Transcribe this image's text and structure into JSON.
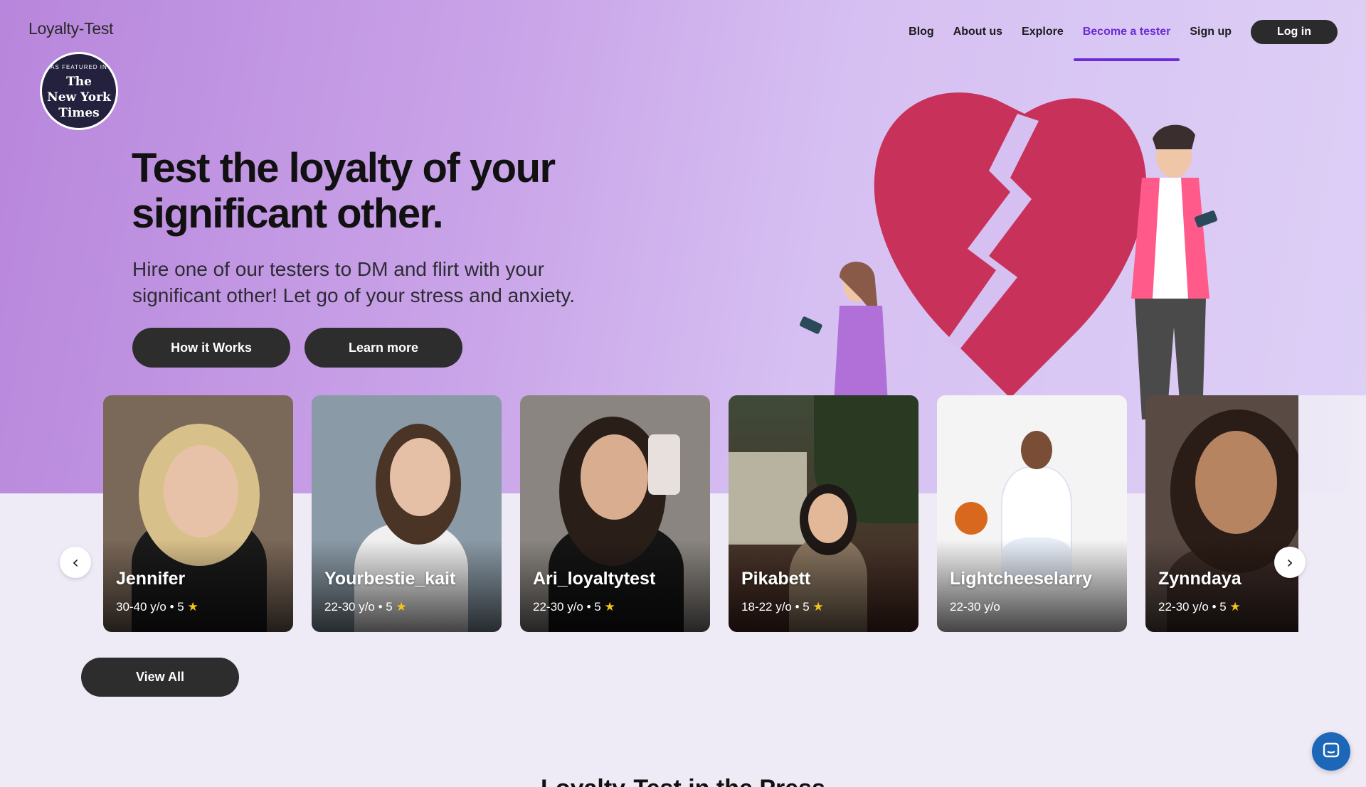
{
  "header": {
    "brand": "Loyalty-Test",
    "nav": [
      "Blog",
      "About us",
      "Explore",
      "Become a tester",
      "Sign up"
    ],
    "active_nav": "Become a tester",
    "login_label": "Log in"
  },
  "badge": {
    "top_text": "AS FEATURED IN",
    "logo_line1": "The",
    "logo_line2": "New York",
    "logo_line3": "Times"
  },
  "hero": {
    "headline": "Test the loyalty of your significant other.",
    "subtext": "Hire one of our testers to DM and flirt with your significant other! Let go of your stress and anxiety.",
    "primary_button": "How it Works",
    "secondary_button": "Learn more"
  },
  "testers": [
    {
      "name": "Jennifer",
      "age": "30-40 y/o",
      "rating": "5",
      "bg": "#7a6858",
      "skin": "#e8c2a8",
      "hair": "#d8c08a"
    },
    {
      "name": "Yourbestie_kait",
      "age": "22-30 y/o",
      "rating": "5",
      "bg": "#8a9aa6",
      "skin": "#e6c0a6",
      "hair": "#4a3426"
    },
    {
      "name": "Ari_loyaltytest",
      "age": "22-30 y/o",
      "rating": "5",
      "bg": "#8a8580",
      "skin": "#d9ad90",
      "hair": "#2a1e18"
    },
    {
      "name": "Pikabett",
      "age": "18-22 y/o",
      "rating": "5",
      "bg": "#3f4a38",
      "skin": "#e2b898",
      "hair": "#1e1816"
    },
    {
      "name": "Lightcheeselarry",
      "age": "22-30 y/o",
      "rating": "",
      "bg": "#f4f4f4",
      "skin": "#7a4e36",
      "hair": "#1a1210"
    },
    {
      "name": "Zynndaya",
      "age": "22-30 y/o",
      "rating": "5",
      "bg": "#5a4a44",
      "skin": "#b78462",
      "hair": "#2a1c16"
    }
  ],
  "view_all_label": "View All",
  "section_title": "Loyalty-Test in the Press",
  "colors": {
    "accent": "#6b2bd6",
    "button_dark": "#2d2d2d",
    "heart": "#c8325a",
    "chat": "#1c67b8"
  },
  "icons": {
    "prev": "chevron-left-icon",
    "next": "chevron-right-icon",
    "star": "star-icon",
    "chat": "chat-icon"
  }
}
